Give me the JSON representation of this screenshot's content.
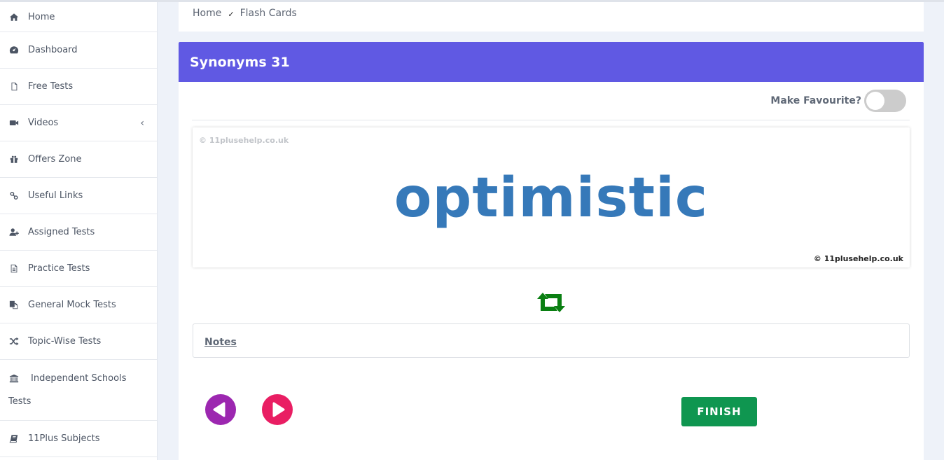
{
  "sidebar": {
    "items": [
      {
        "label": "Home",
        "icon": "home-icon"
      },
      {
        "label": "Dashboard",
        "icon": "dashboard-icon"
      },
      {
        "label": "Free Tests",
        "icon": "file-icon"
      },
      {
        "label": "Videos",
        "icon": "video-camera-icon",
        "has_submenu": true
      },
      {
        "label": "Offers Zone",
        "icon": "gift-icon"
      },
      {
        "label": "Useful Links",
        "icon": "link-icon"
      },
      {
        "label": "Assigned Tests",
        "icon": "user-plus-icon"
      },
      {
        "label": "Practice Tests",
        "icon": "document-icon"
      },
      {
        "label": "General Mock Tests",
        "icon": "copy-icon"
      },
      {
        "label": "Topic-Wise Tests",
        "icon": "shuffle-icon"
      },
      {
        "label_line1": "Independent Schools",
        "label_line2": "Tests",
        "icon": "bank-icon"
      },
      {
        "label": "11Plus Subjects",
        "icon": "book-icon"
      }
    ],
    "chevron": "‹"
  },
  "breadcrumb": {
    "home": "Home",
    "separator": "✓",
    "current": "Flash Cards"
  },
  "card": {
    "title": "Synonyms 31",
    "favourite_label": "Make Favourite?",
    "favourite_on": false,
    "watermark_top": "© 11plusehelp.co.uk",
    "watermark_bottom": "© 11plusehelp.co.uk",
    "word": "optimistic",
    "notes_label": "Notes",
    "finish_label": "FINISH"
  },
  "colors": {
    "header": "#6059e3",
    "word": "#3679b9",
    "flip_icon": "#0a7f12",
    "prev_button": "#9c27b0",
    "next_button": "#e91e63",
    "finish_button": "#0f9650"
  }
}
